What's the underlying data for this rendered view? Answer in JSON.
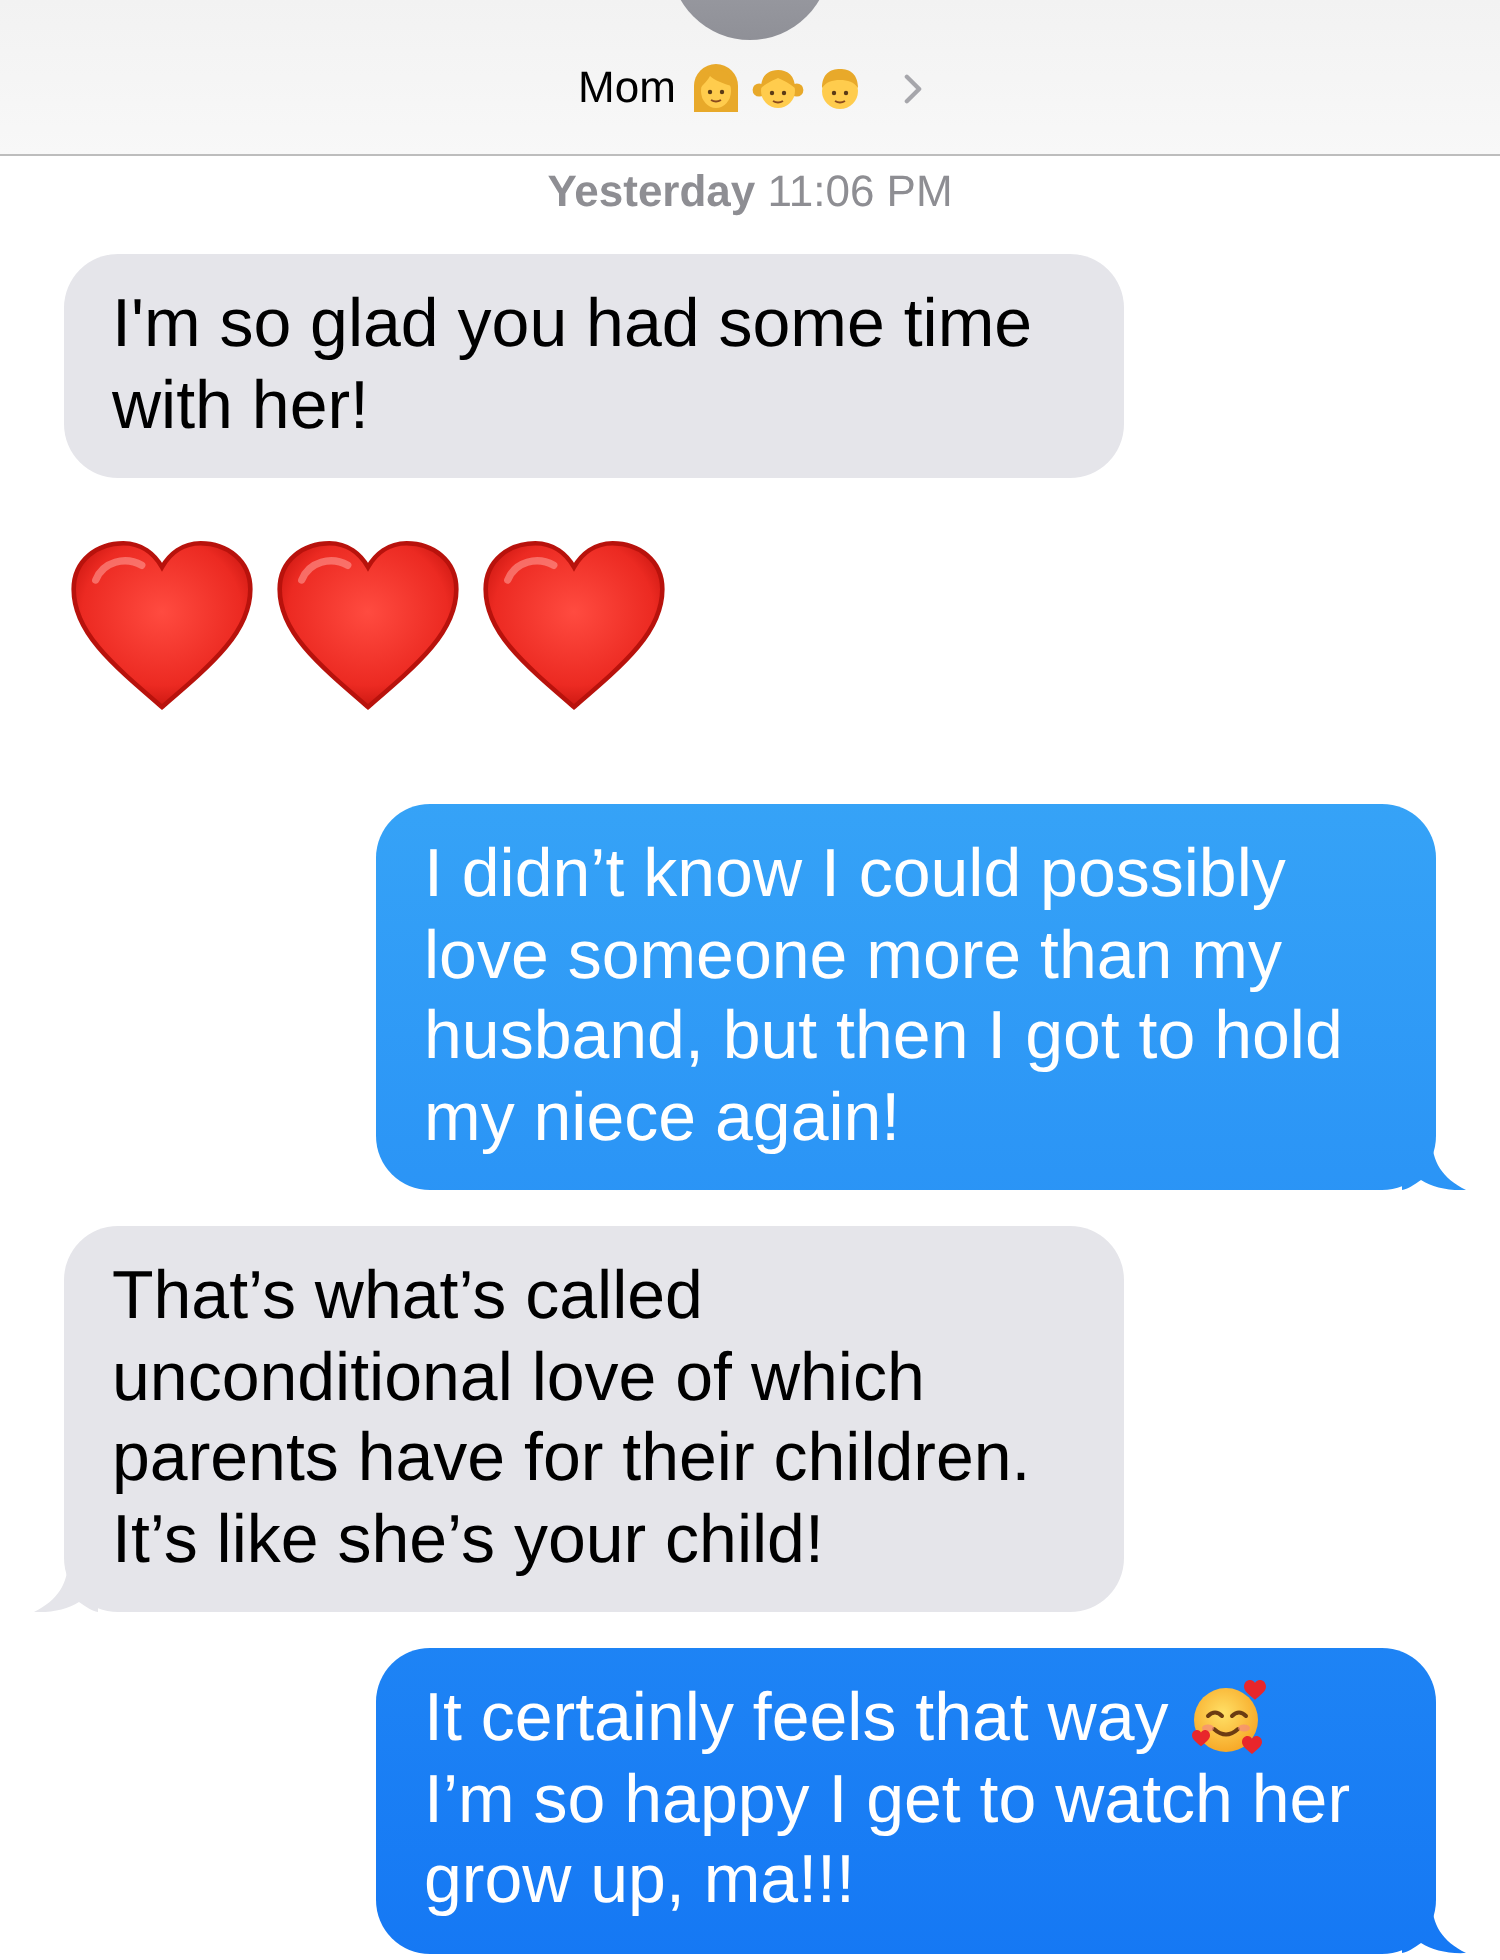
{
  "header": {
    "contact_name": "Mom",
    "contact_emojis": [
      {
        "kind": "woman"
      },
      {
        "kind": "girl"
      },
      {
        "kind": "boy"
      }
    ]
  },
  "timestamp": "**Yesterday** 11:06 PM",
  "messages": [
    {
      "kind": "text",
      "outgoing": false,
      "tail": false,
      "parts": [
        {
          "kind": "text",
          "text": "I'm so glad you had some time with her!"
        }
      ]
    },
    {
      "kind": "emoji_row",
      "outgoing": false,
      "emojis": [
        {
          "kind": "heart"
        },
        {
          "kind": "heart"
        },
        {
          "kind": "heart"
        }
      ]
    },
    {
      "kind": "text",
      "outgoing": true,
      "tail": true,
      "parts": [
        {
          "kind": "text",
          "text": "I didn’t know I could possibly love someone more than my husband, but then I got to hold my niece again!"
        }
      ]
    },
    {
      "kind": "text",
      "outgoing": false,
      "tail": true,
      "parts": [
        {
          "kind": "text",
          "text": "That’s what’s called unconditional love of which parents have for their children. It’s like she’s your child!"
        }
      ]
    },
    {
      "kind": "text",
      "outgoing": true,
      "tail": true,
      "parts": [
        {
          "kind": "text",
          "text": "It certainly feels that way"
        },
        {
          "kind": "smiling_face_hearts"
        },
        {
          "kind": "text",
          "text": "I’m so happy I get to watch her grow up, ma!!!"
        }
      ]
    }
  ]
}
